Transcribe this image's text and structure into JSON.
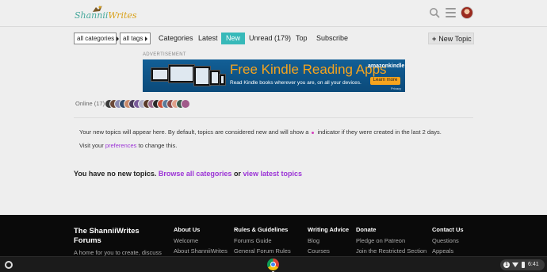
{
  "header": {
    "logo_text_a": "Shannii",
    "logo_text_b": "Writes"
  },
  "filters": {
    "categories_label": "all categories",
    "tags_label": "all tags"
  },
  "tabs": [
    {
      "label": "Categories",
      "active": false
    },
    {
      "label": "Latest",
      "active": false
    },
    {
      "label": "New",
      "active": true
    },
    {
      "label": "Unread (179)",
      "active": false
    },
    {
      "label": "Top",
      "active": false
    },
    {
      "label": "Subscribe",
      "active": false
    }
  ],
  "new_topic_label": "New Topic",
  "advertisement": {
    "label": "ADVERTISEMENT",
    "title": "Free Kindle Reading Apps",
    "subtitle": "Read Kindle books wherever you are, on all your devices.",
    "brand": "amazonkindle",
    "cta": "Learn more",
    "privacy": "Privacy"
  },
  "online": {
    "label": "Online (17):",
    "avatar_colors": [
      "#3b3b3b",
      "#6d4b3a",
      "#8a8ab0",
      "#2f4b6b",
      "#c98a6a",
      "#4a3a5a",
      "#7a5a9a",
      "#b0b0c8",
      "#5a3a2a",
      "#9a6a8a",
      "#2a2a2a",
      "#c9503a",
      "#5a7a9a",
      "#8a4a4a",
      "#e0a08a",
      "#3a5a4a",
      "#a05a8a"
    ]
  },
  "info": {
    "line1_a": "Your new topics will appear here. By default, topics are considered new and will show a",
    "line1_b": "indicator if they were created in the last 2 days.",
    "line2_a": "Visit your",
    "line2_link": "preferences",
    "line2_b": "to change this."
  },
  "empty_state": {
    "text": "You have no new topics.",
    "link1": "Browse all categories",
    "or": "or",
    "link2": "view latest topics"
  },
  "footer": {
    "title": "The ShanniiWrites Forums",
    "desc": "A home for you to create, discuss",
    "columns": [
      {
        "heading": "About Us",
        "items": [
          "Welcome",
          "About ShanniiWrites"
        ]
      },
      {
        "heading": "Rules & Guidelines",
        "items": [
          "Forums Guide",
          "General Forum Rules"
        ]
      },
      {
        "heading": "Writing Advice",
        "items": [
          "Blog",
          "Courses"
        ]
      },
      {
        "heading": "Donate",
        "items": [
          "Pledge on Patreon",
          "Join the Restricted Section"
        ]
      },
      {
        "heading": "Contact Us",
        "items": [
          "Questions",
          "Appeals"
        ]
      }
    ]
  },
  "shelf": {
    "notification_count": "1",
    "time": "6:41"
  },
  "colors": {
    "accent_tab": "#37b9b9",
    "link": "#9b33d6",
    "new_indicator": "#d33fbd"
  }
}
